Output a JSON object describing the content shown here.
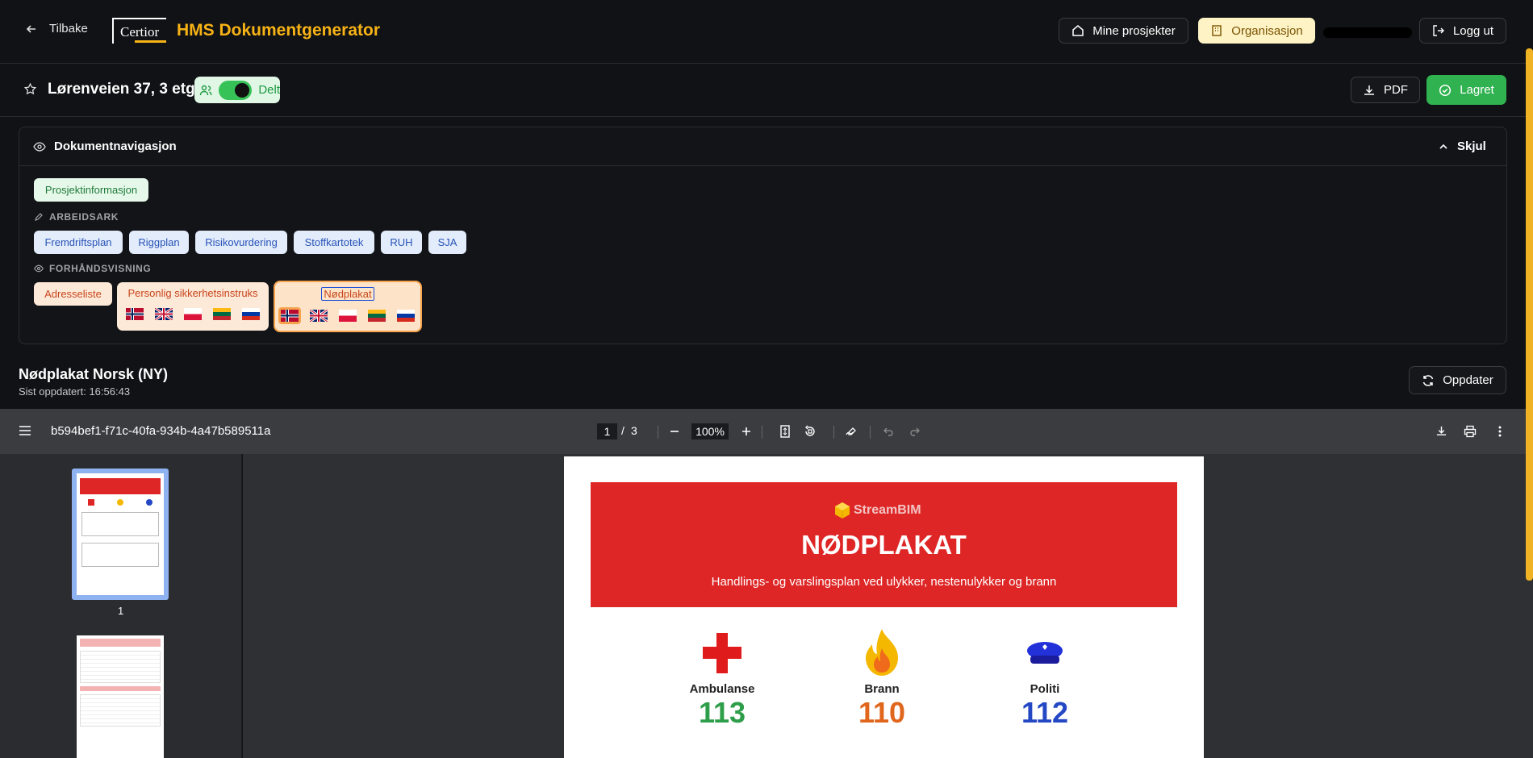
{
  "header": {
    "back_label": "Tilbake",
    "logo_text": "Certior",
    "app_title": "HMS Dokumentgenerator",
    "my_projects": "Mine prosjekter",
    "organisation": "Organisasjon",
    "logout": "Logg ut"
  },
  "project": {
    "name": "Lørenveien 37, 3 etg.",
    "shared_label": "Delt",
    "pdf_label": "PDF",
    "saved_label": "Lagret"
  },
  "nav": {
    "title": "Dokumentnavigasjon",
    "hide_label": "Skjul",
    "project_info": "Prosjektinformasjon",
    "worksheets_heading": "ARBEIDSARK",
    "worksheets": [
      "Fremdriftsplan",
      "Riggplan",
      "Risikovurdering",
      "Stoffkartotek",
      "RUH",
      "SJA"
    ],
    "preview_heading": "FORHÅNDSVISNING",
    "previews": [
      "Adresseliste",
      "Personlig sikkerhetsinstruks",
      "Nødplakat"
    ]
  },
  "document": {
    "title": "Nødplakat Norsk (NY)",
    "last_updated": "Sist oppdatert: 16:56:43",
    "update_label": "Oppdater"
  },
  "pdf_viewer": {
    "filename": "b594bef1-f71c-40fa-934b-4a47b589511a",
    "current_page": "1",
    "page_sep": "/",
    "total_pages": "3",
    "zoom": "100%",
    "thumb_label": "1"
  },
  "poster": {
    "brand": "StreamBIM",
    "title": "NØDPLAKAT",
    "subtitle": "Handlings- og varslingsplan ved ulykker, nestenulykker og brann",
    "services": [
      {
        "name": "Ambulanse",
        "number": "113",
        "color": "#2e9e4a"
      },
      {
        "name": "Brann",
        "number": "110",
        "color": "#e0661c"
      },
      {
        "name": "Politi",
        "number": "112",
        "color": "#2447c4"
      }
    ]
  },
  "colors": {
    "accent": "#f7b316",
    "green": "#2fb24f",
    "poster_red": "#de2626"
  },
  "flags": [
    "norway-flag",
    "uk-flag",
    "poland-flag",
    "lithuania-flag",
    "russia-flag"
  ]
}
